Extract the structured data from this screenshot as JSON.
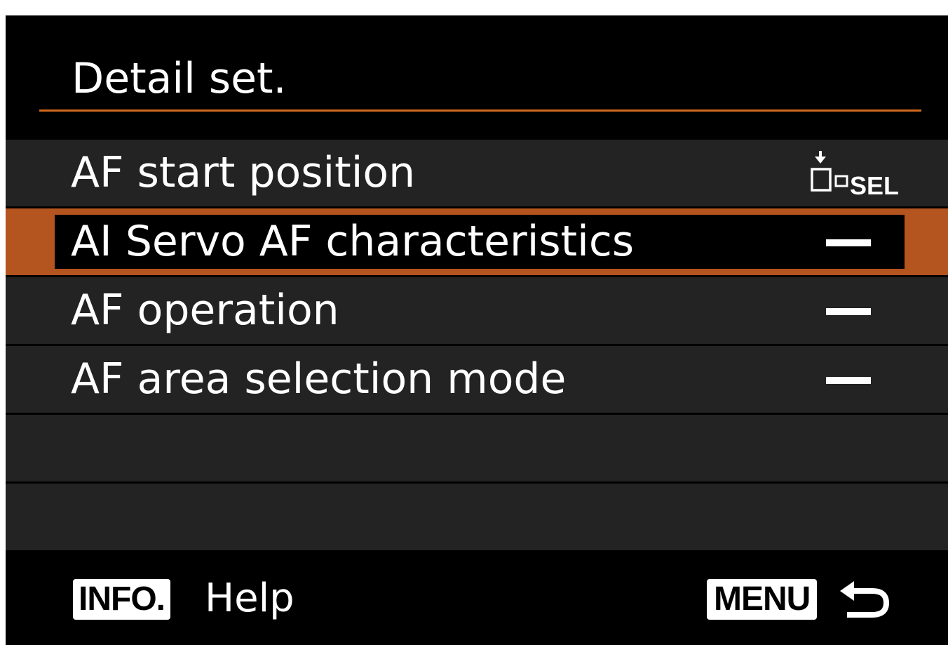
{
  "screen": {
    "title": "Detail set."
  },
  "menu": {
    "rows": [
      {
        "label": "AF start position",
        "value_icon": "af-point-select-sel-icon",
        "value_text": "SEL"
      },
      {
        "label": "AI Servo AF characteristics",
        "value_icon": "dash-icon",
        "selected": true
      },
      {
        "label": "AF operation",
        "value_icon": "dash-icon"
      },
      {
        "label": "AF area selection mode",
        "value_icon": "dash-icon"
      },
      {
        "label": ""
      },
      {
        "label": ""
      }
    ]
  },
  "footer": {
    "info_button": "INFO.",
    "info_action": "Help",
    "menu_button": "MENU",
    "menu_action_icon": "back-arrow-icon"
  },
  "colors": {
    "background": "#000000",
    "row_background": "#232323",
    "accent": "#d2691e",
    "selected_highlight": "#b4541e",
    "text": "#ffffff"
  }
}
